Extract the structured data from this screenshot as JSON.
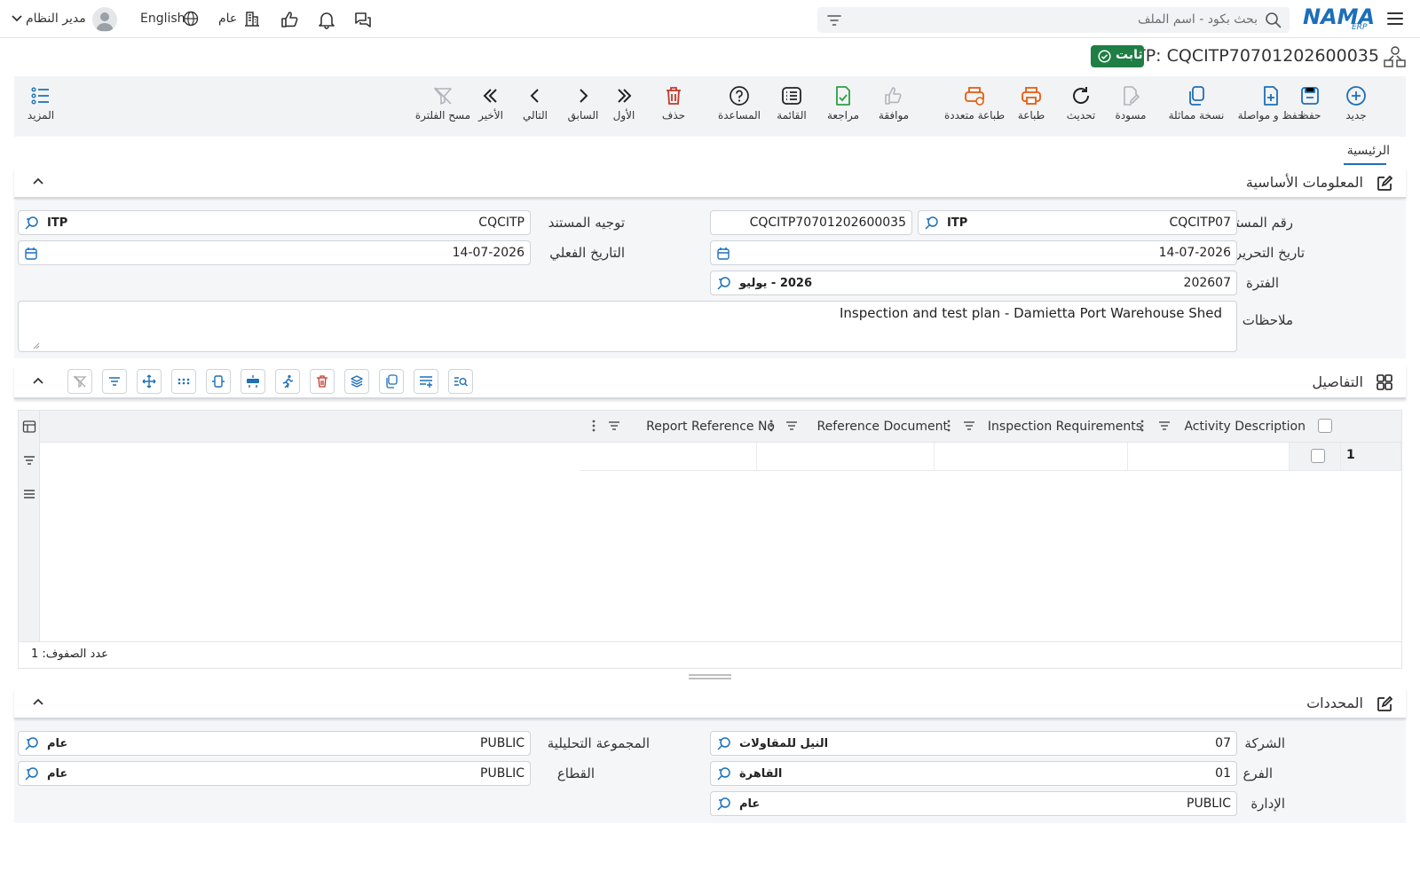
{
  "topbar": {
    "search_placeholder": "بحث بكود - اسم الملف",
    "logo_text": "NAMA",
    "logo_sub": "ERP",
    "user_name": "مدير النظام",
    "language": "English",
    "company_scope": "عام"
  },
  "document": {
    "title": "ITP: CQCITP70701202600035",
    "status": "ثابت"
  },
  "toolbar": {
    "new": "جديد",
    "save": "حفظ",
    "save_continue": "حفظ و مواصلة",
    "duplicate": "نسخة مماثلة",
    "draft": "مسودة",
    "refresh": "تحديث",
    "print": "طباعة",
    "multi_print": "طباعة متعددة",
    "approve": "موافقة",
    "review": "مراجعة",
    "list": "القائمة",
    "help": "المساعدة",
    "delete": "حذف",
    "first": "الأول",
    "previous": "السابق",
    "next": "التالي",
    "last": "الأخير",
    "clear_filter": "مسح الفلترة",
    "more": "المزيد"
  },
  "tabs": {
    "main": "الرئيسية"
  },
  "basic": {
    "section_title": "المعلومات الأساسية",
    "doc_number_label": "رقم المستند",
    "doc_number_prefix": "CQCITP07",
    "doc_number_tag": "ITP",
    "doc_number_full": "CQCITP70701202600035",
    "direction_label": "توجيه المستند",
    "direction_value": "CQCITP",
    "direction_tag": "ITP",
    "edit_date_label": "تاريخ التحرير",
    "edit_date": "14-07-2026",
    "actual_date_label": "التاريخ الفعلي",
    "actual_date": "14-07-2026",
    "period_label": "الفترة",
    "period_code": "202607",
    "period_name": "2026 - يوليو",
    "notes_label": "ملاحظات",
    "notes": "Inspection and test plan - Damietta Port Warehouse Shed"
  },
  "details": {
    "section_title": "التفاصيل",
    "columns": [
      "Activity Description",
      "Inspection Requirements",
      "Reference Document",
      "Report Reference No"
    ],
    "rows": [
      {
        "num": "1"
      }
    ],
    "row_count_text": "عدد الصفوف: 1"
  },
  "dimensions": {
    "section_title": "المحددات",
    "company_label": "الشركة",
    "company_code": "07",
    "company_name": "النيل للمقاولات",
    "branch_label": "الفرع",
    "branch_code": "01",
    "branch_name": "القاهرة",
    "department_label": "الإدارة",
    "department_code": "PUBLIC",
    "department_name": "عام",
    "analytic_label": "المجموعة التحليلية",
    "analytic_code": "PUBLIC",
    "analytic_name": "عام",
    "sector_label": "القطاع",
    "sector_code": "PUBLIC",
    "sector_name": "عام"
  },
  "colors": {
    "brand": "#1c6fb8",
    "status_green": "#1e7e44",
    "print_orange": "#e8590c",
    "delete_red": "#c0392b",
    "review_green": "#2f9e44"
  }
}
